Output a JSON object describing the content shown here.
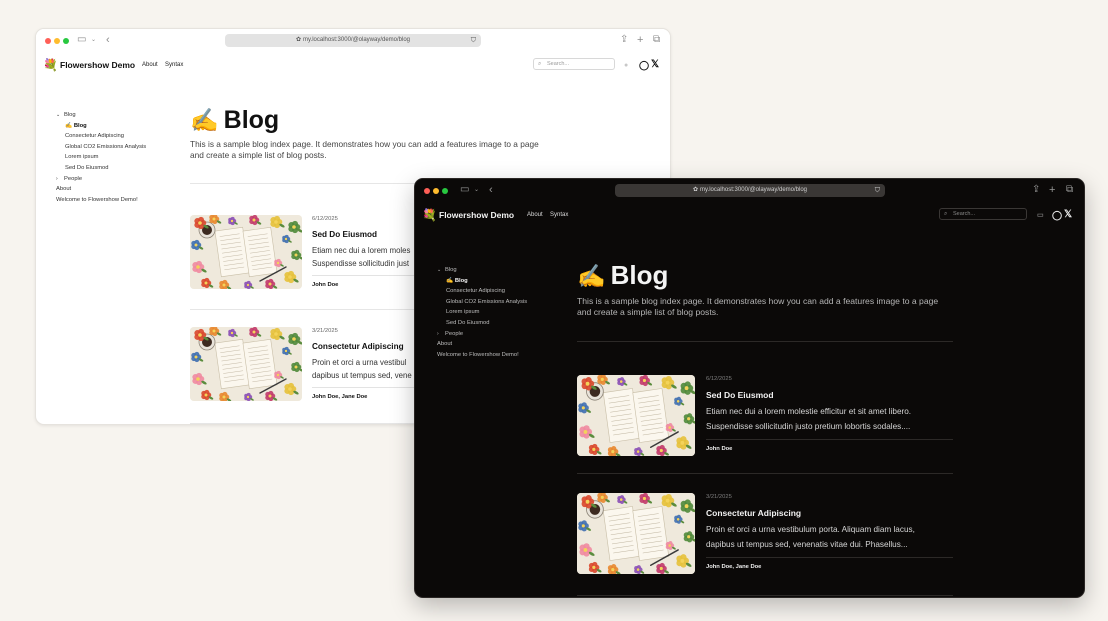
{
  "light": {
    "url": "my.localhost:3000/@olayway/demo/blog",
    "brand": "Flowershow Demo",
    "nav": [
      "About",
      "Syntax"
    ],
    "search_placeholder": "Search...",
    "sidebar": [
      {
        "label": "Blog",
        "chevron": "⌄"
      },
      {
        "label": "✍️ Blog"
      },
      {
        "label": "Consectetur Adipiscing"
      },
      {
        "label": "Global CO2 Emissions Analysis"
      },
      {
        "label": "Lorem ipsum"
      },
      {
        "label": "Sed Do Eiusmod"
      },
      {
        "label": "People",
        "chevron": "›"
      },
      {
        "label": "About"
      },
      {
        "label": "Welcome to Flowershow Demo!"
      }
    ],
    "title_emoji": "✍️",
    "title": "Blog",
    "intro": "This is a sample blog index page. It demonstrates how you can add a features image to a page and create a simple list of blog posts.",
    "posts": [
      {
        "date": "6/12/2025",
        "title": "Sed Do Eiusmod",
        "line1": "Etiam nec dui a lorem moles",
        "line2": "Suspendisse sollicitudin just",
        "authors": "John Doe"
      },
      {
        "date": "3/21/2025",
        "title": "Consectetur Adipiscing",
        "line1": "Proin et orci a urna vestibul",
        "line2": "dapibus ut tempus sed, vene",
        "authors": "John Doe, Jane Doe"
      }
    ]
  },
  "dark": {
    "url": "my.localhost:3000/@olayway/demo/blog",
    "brand": "Flowershow Demo",
    "nav": [
      "About",
      "Syntax"
    ],
    "search_placeholder": "Search...",
    "sidebar": [
      {
        "label": "Blog",
        "chevron": "⌄"
      },
      {
        "label": "✍️ Blog"
      },
      {
        "label": "Consectetur Adipiscing"
      },
      {
        "label": "Global CO2 Emissions Analysis"
      },
      {
        "label": "Lorem ipsum"
      },
      {
        "label": "Sed Do Eiusmod"
      },
      {
        "label": "People",
        "chevron": "›"
      },
      {
        "label": "About"
      },
      {
        "label": "Welcome to Flowershow Demo!"
      }
    ],
    "title_emoji": "✍️",
    "title": "Blog",
    "intro": "This is a sample blog index page. It demonstrates how you can add a features image to a page and create a simple list of blog posts.",
    "posts": [
      {
        "date": "6/12/2025",
        "title": "Sed Do Eiusmod",
        "line1": "Etiam nec dui a lorem molestie efficitur et sit amet libero.",
        "line2": "Suspendisse sollicitudin justo pretium lobortis sodales....",
        "authors": "John Doe"
      },
      {
        "date": "3/21/2025",
        "title": "Consectetur Adipiscing",
        "line1": "Proin et orci a urna vestibulum porta. Aliquam diam lacus,",
        "line2": "dapibus ut tempus sed, venenatis vitae dui. Phasellus...",
        "authors": "John Doe, Jane Doe"
      }
    ]
  },
  "icons": {
    "logo": "flower-logo-icon",
    "github": "github-icon",
    "x": "x-logo-icon",
    "theme": "theme-toggle-icon",
    "share": "share-icon",
    "new_tab": "new-tab-icon",
    "tabs": "tabs-overview-icon",
    "sidebar": "sidebar-toggle-icon",
    "back": "back-arrow-icon",
    "search": "search-icon"
  },
  "colors": {
    "light_bg": "#ffffff",
    "dark_bg": "#0b0908",
    "page_bg": "#f7f4ef"
  }
}
